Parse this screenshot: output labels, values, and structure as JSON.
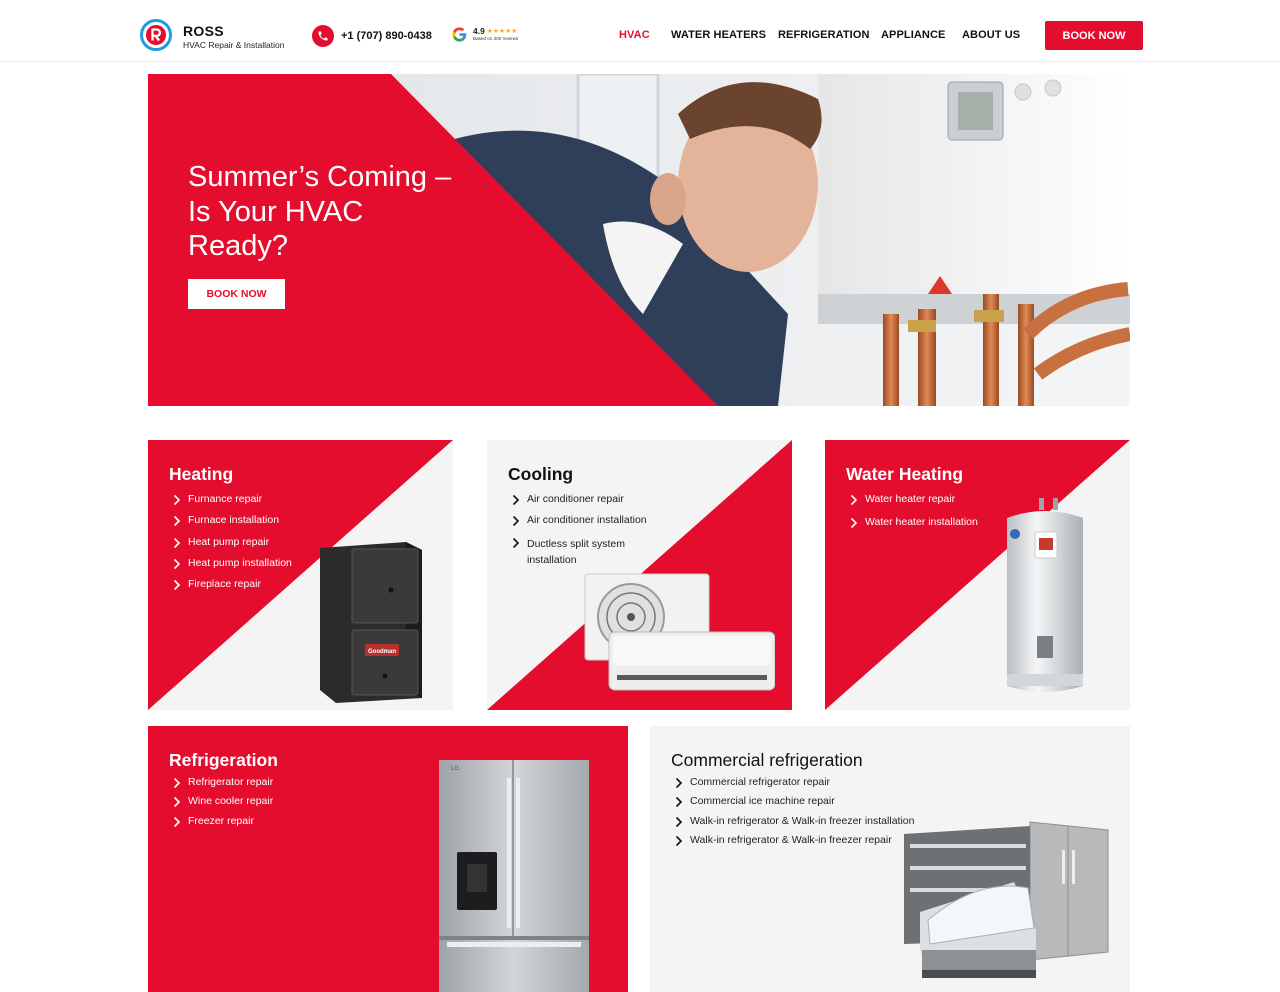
{
  "header": {
    "brand_name": "ROSS",
    "brand_tagline": "HVAC Repair & Installation",
    "phone": "+1 (707) 890-0438",
    "rating_score": "4.9",
    "rating_stars": "★★★★★",
    "rating_reviews": "Based on 200 reviews",
    "nav": [
      "HVAC",
      "WATER HEATERS",
      "REFRIGERATION",
      "APPLIANCE",
      "ABOUT US"
    ],
    "active_nav": "HVAC",
    "book_label": "BOOK NOW"
  },
  "hero": {
    "title": "Summer’s Coming – Is Your HVAC Ready?",
    "button_label": "BOOK NOW"
  },
  "cards": [
    {
      "title": "Heating",
      "items": [
        "Furnance repair",
        "Furnace installation",
        "Heat pump repair",
        "Heat pump installation",
        "Fireplace repair"
      ],
      "product_label": "Goodman"
    },
    {
      "title": "Cooling",
      "items": [
        "Air conditioner repair",
        "Air conditioner installation",
        "Ductless split system installation"
      ]
    },
    {
      "title": "Water Heating",
      "items": [
        "Water heater repair",
        "Water heater installation"
      ]
    },
    {
      "title": "Refrigeration",
      "items": [
        "Refrigerator repair",
        "Wine cooler repair",
        "Freezer repair"
      ],
      "product_label": "LG"
    },
    {
      "title": "Commercial refrigeration",
      "items": [
        "Commercial refrigerator repair",
        "Commercial ice machine repair",
        "Walk-in refrigerator & Walk-in freezer installation",
        "Walk-in refrigerator & Walk-in freezer repair"
      ]
    }
  ],
  "colors": {
    "accent": "#e50d2e",
    "card_light": "#f4f4f4",
    "text_dark": "#111111"
  },
  "icons": [
    "ross-logo-icon",
    "phone-icon",
    "google-icon",
    "chevron-right-icon"
  ]
}
